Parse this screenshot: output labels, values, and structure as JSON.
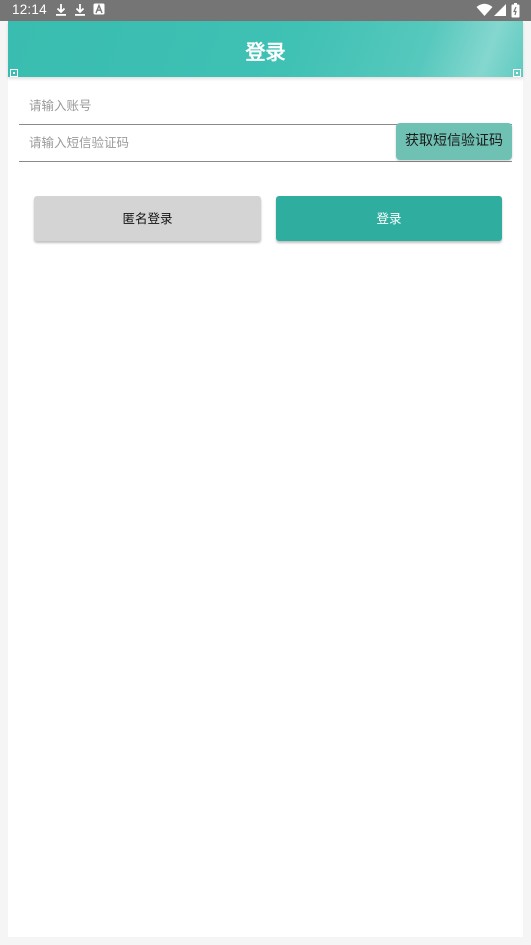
{
  "status_bar": {
    "time": "12:14",
    "left_icons": [
      "download-icon",
      "download-icon",
      "font-a-icon"
    ],
    "right_icons": [
      "wifi-icon",
      "signal-icon",
      "battery-icon"
    ]
  },
  "header": {
    "title": "登录"
  },
  "form": {
    "account_placeholder": "请输入账号",
    "sms_code_placeholder": "请输入短信验证码",
    "get_sms_code_label": "获取短信验证码"
  },
  "actions": {
    "anonymous_login_label": "匿名登录",
    "login_label": "登录"
  },
  "colors": {
    "accent": "#2fae9f",
    "header": "#3fc1b4",
    "status_bar": "#757575",
    "secondary_button": "#d4d4d4"
  }
}
